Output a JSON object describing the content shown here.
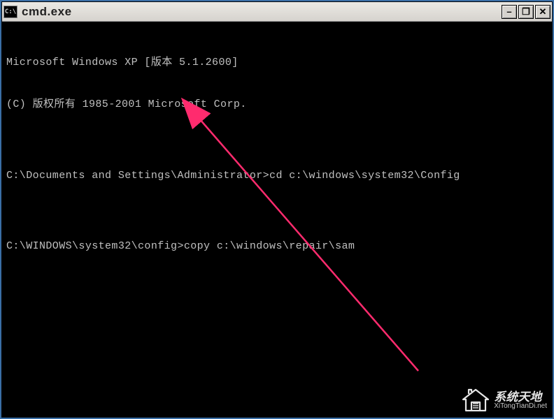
{
  "titlebar": {
    "icon_label": "C:\\",
    "title": "cmd.exe",
    "minimize": "–",
    "maximize": "❐",
    "close": "✕"
  },
  "terminal": {
    "line1": "Microsoft Windows XP [版本 5.1.2600]",
    "line2": "(C) 版权所有 1985-2001 Microsoft Corp.",
    "blank1": "",
    "line3": "C:\\Documents and Settings\\Administrator>cd c:\\windows\\system32\\Config",
    "blank2": "",
    "line4": "C:\\WINDOWS\\system32\\config>copy c:\\windows\\repair\\sam"
  },
  "watermark": {
    "main": "系统天地",
    "sub": "XiTongTianDi.net"
  },
  "annotation": {
    "arrow_color": "#ff2b6e"
  }
}
